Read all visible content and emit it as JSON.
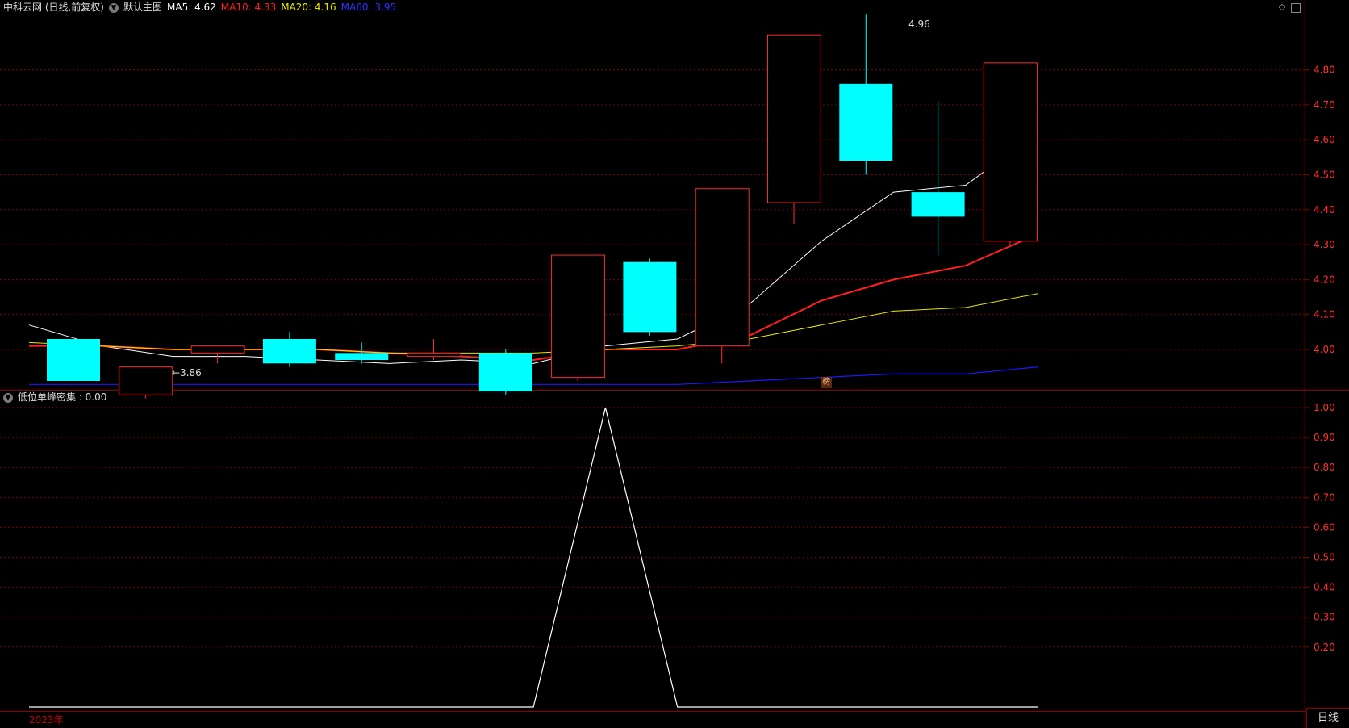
{
  "header": {
    "stock": "中科云网 (日线,前复权)",
    "main_chart": "默认主图",
    "ma5": "MA5: 4.62",
    "ma10": "MA10: 4.33",
    "ma20": "MA20: 4.16",
    "ma60": "MA60: 3.95"
  },
  "indicator": {
    "label": "低位单峰密集 : 0.00"
  },
  "footer": {
    "year": "2023年",
    "period_tab": "日线"
  },
  "badge": "榜",
  "annotations": {
    "low": "←3.86",
    "high": "4.96"
  },
  "colors": {
    "up": "#ff2b2b",
    "down": "#00ffff",
    "ma5": "#ffffff",
    "ma10": "#ff2020",
    "ma20": "#e6e600",
    "ma60": "#1a1aff",
    "grid": "#7a0000"
  },
  "chart_data": [
    {
      "type": "candlestick",
      "title": "中科云网 (日线,前复权)",
      "y_ticks": [
        "4.80",
        "4.70",
        "4.60",
        "4.50",
        "4.40",
        "4.30",
        "4.20",
        "4.10",
        "4.00"
      ],
      "ylim": [
        3.83,
        4.99
      ],
      "candles": [
        {
          "open": 4.03,
          "close": 3.91,
          "high": 4.03,
          "low": 3.91
        },
        {
          "open": 3.87,
          "close": 3.95,
          "high": 3.95,
          "low": 3.86
        },
        {
          "open": 3.99,
          "close": 4.01,
          "high": 4.01,
          "low": 3.96
        },
        {
          "open": 4.03,
          "close": 3.96,
          "high": 4.05,
          "low": 3.95
        },
        {
          "open": 3.99,
          "close": 3.97,
          "high": 4.02,
          "low": 3.96
        },
        {
          "open": 3.98,
          "close": 3.99,
          "high": 4.03,
          "low": 3.97
        },
        {
          "open": 3.99,
          "close": 3.88,
          "high": 4.0,
          "low": 3.87
        },
        {
          "open": 3.92,
          "close": 4.27,
          "high": 4.27,
          "low": 3.91
        },
        {
          "open": 4.25,
          "close": 4.05,
          "high": 4.26,
          "low": 4.04
        },
        {
          "open": 4.01,
          "close": 4.46,
          "high": 4.46,
          "low": 3.96
        },
        {
          "open": 4.42,
          "close": 4.9,
          "high": 4.9,
          "low": 4.36
        },
        {
          "open": 4.76,
          "close": 4.54,
          "high": 4.96,
          "low": 4.5
        },
        {
          "open": 4.45,
          "close": 4.38,
          "high": 4.71,
          "low": 4.27
        },
        {
          "open": 4.31,
          "close": 4.82,
          "high": 4.82,
          "low": 4.3
        }
      ],
      "series": [
        {
          "name": "MA5",
          "values": [
            4.07,
            4.01,
            3.98,
            3.98,
            3.97,
            3.96,
            3.97,
            3.96,
            4.01,
            4.03,
            4.13,
            4.31,
            4.45,
            4.47,
            4.62
          ]
        },
        {
          "name": "MA10",
          "values": [
            4.01,
            4.01,
            4.0,
            4.0,
            4.0,
            3.99,
            3.98,
            3.97,
            4.0,
            4.0,
            4.04,
            4.14,
            4.2,
            4.24,
            4.33
          ]
        },
        {
          "name": "MA20",
          "values": [
            4.02,
            4.01,
            4.0,
            4.0,
            4.0,
            3.99,
            3.99,
            3.99,
            4.0,
            4.01,
            4.03,
            4.07,
            4.11,
            4.12,
            4.16
          ]
        },
        {
          "name": "MA60",
          "values": [
            3.9,
            3.9,
            3.9,
            3.9,
            3.9,
            3.9,
            3.9,
            3.9,
            3.9,
            3.9,
            3.91,
            3.92,
            3.93,
            3.93,
            3.95
          ]
        }
      ]
    },
    {
      "type": "line",
      "title": "低位单峰密集",
      "y_ticks": [
        "1.00",
        "0.90",
        "0.80",
        "0.70",
        "0.60",
        "0.50",
        "0.40",
        "0.30",
        "0.20"
      ],
      "ylim": [
        0,
        1
      ],
      "series": [
        {
          "name": "低位单峰密集",
          "values": [
            0,
            0,
            0,
            0,
            0,
            0,
            0,
            0,
            1,
            0,
            0,
            0,
            0,
            0,
            0
          ]
        }
      ]
    }
  ]
}
